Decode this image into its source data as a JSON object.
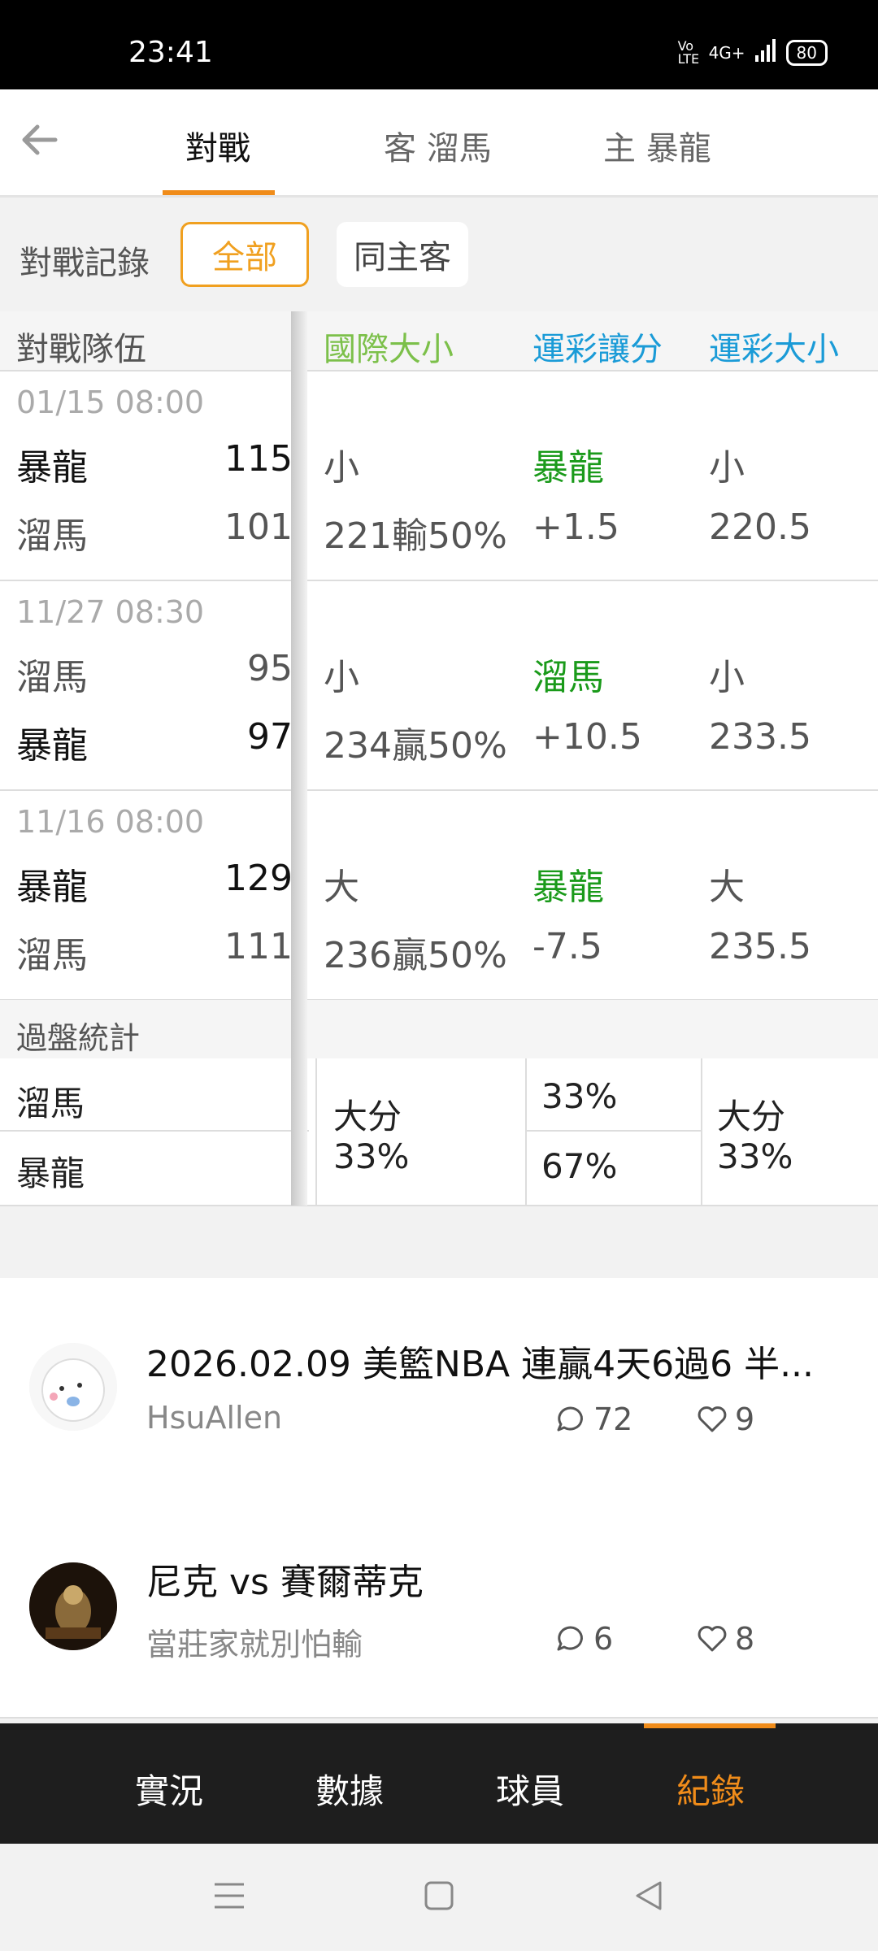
{
  "status": {
    "time": "23:41",
    "network": "4G+",
    "volte": "Vo LTE",
    "battery": "80"
  },
  "tabs": {
    "back_icon": "arrow-left-icon",
    "items": [
      "對戰",
      "客 溜馬",
      "主 暴龍"
    ],
    "active": 0
  },
  "filter": {
    "label": "對戰記錄",
    "all": "全部",
    "same_home_away": "同主客"
  },
  "table": {
    "headers": [
      "對戰隊伍",
      "國際大小",
      "運彩讓分",
      "運彩大小"
    ],
    "header_colors": [
      "#555555",
      "#7cc04a",
      "#1a9bd7",
      "#1a9bd7"
    ],
    "games": [
      {
        "date": "01/15 08:00",
        "team1": "暴龍",
        "score1": "115",
        "team2": "溜馬",
        "score2": "101",
        "intl_top": "小",
        "intl_bot": "221輸50%",
        "spread_top": "暴龍",
        "spread_bot": "+1.5",
        "ou_top": "小",
        "ou_bot": "220.5"
      },
      {
        "date": "11/27 08:30",
        "team1": "溜馬",
        "score1": "95",
        "team2": "暴龍",
        "score2": "97",
        "intl_top": "小",
        "intl_bot": "234贏50%",
        "spread_top": "溜馬",
        "spread_bot": "+10.5",
        "ou_top": "小",
        "ou_bot": "233.5"
      },
      {
        "date": "11/16 08:00",
        "team1": "暴龍",
        "score1": "129",
        "team2": "溜馬",
        "score2": "111",
        "intl_top": "大",
        "intl_bot": "236贏50%",
        "spread_top": "暴龍",
        "spread_bot": "-7.5",
        "ou_top": "大",
        "ou_bot": "235.5"
      }
    ],
    "team_highlight": "暴龍"
  },
  "stats": {
    "label": "過盤統計",
    "team_a": "溜馬",
    "team_b": "暴龍",
    "intl_label": "大分",
    "intl_pct": "33%",
    "spread_a": "33%",
    "spread_b": "67%",
    "ou_label": "大分",
    "ou_pct": "33%"
  },
  "posts": [
    {
      "title": "2026.02.09 美籃NBA 連贏4天6過6  半...",
      "author": "HsuAllen",
      "comments": "72",
      "likes": "9"
    },
    {
      "title": "尼克 vs 賽爾蒂克",
      "author": "當莊家就別怕輸",
      "comments": "6",
      "likes": "8"
    }
  ],
  "bottom_nav": {
    "items": [
      "實況",
      "數據",
      "球員",
      "紀錄"
    ],
    "active": 3
  },
  "colors": {
    "accent": "#f08c1a",
    "green": "#1a9a1a",
    "blue": "#1a9bd7",
    "lightgreen": "#7cc04a"
  }
}
